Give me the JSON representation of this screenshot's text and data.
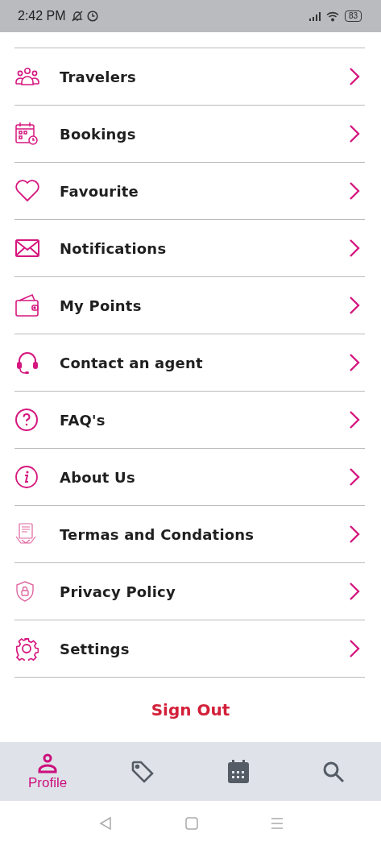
{
  "status_bar": {
    "time": "2:42 PM",
    "battery": "83"
  },
  "menu": [
    {
      "kind": "travelers",
      "label": "Travelers"
    },
    {
      "kind": "bookings",
      "label": "Bookings"
    },
    {
      "kind": "favourite",
      "label": "Favourite"
    },
    {
      "kind": "notifications",
      "label": "Notifications"
    },
    {
      "kind": "points",
      "label": "My Points"
    },
    {
      "kind": "agent",
      "label": "Contact an agent"
    },
    {
      "kind": "faq",
      "label": "FAQ's"
    },
    {
      "kind": "about",
      "label": "About Us"
    },
    {
      "kind": "terms",
      "label": "Termas and Condations"
    },
    {
      "kind": "privacy",
      "label": "Privacy Policy"
    },
    {
      "kind": "settings",
      "label": "Settings"
    }
  ],
  "sign_out": "Sign Out",
  "bottom_nav": [
    {
      "kind": "profile",
      "label": "Profile",
      "selected": true
    },
    {
      "kind": "deals",
      "selected": false
    },
    {
      "kind": "calendar",
      "selected": false
    },
    {
      "kind": "search",
      "selected": false
    }
  ]
}
